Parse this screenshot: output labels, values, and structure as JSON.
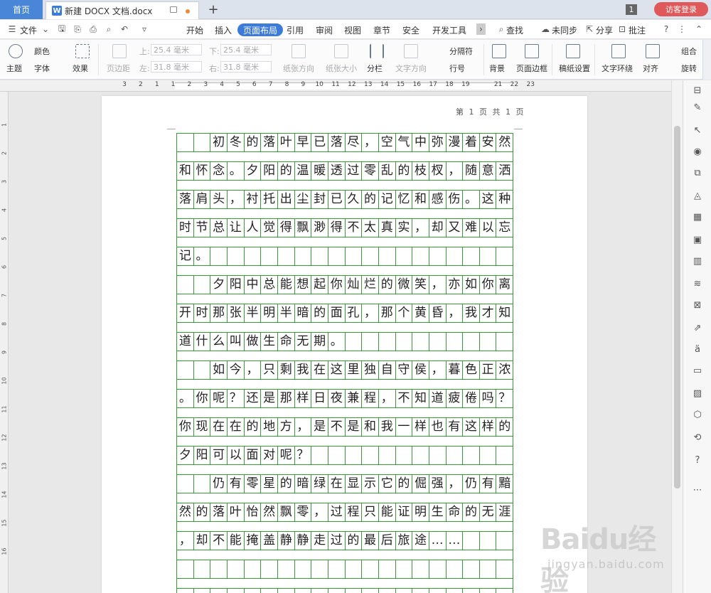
{
  "tabbar": {
    "home_label": "首页",
    "doc_tab_label": "新建 DOCX 文档.docx",
    "new_tab_symbol": "+",
    "window_count": "1",
    "login_label": "访客登录"
  },
  "menu": {
    "file_label": "文件",
    "items": [
      "开始",
      "插入",
      "页面布局",
      "引用",
      "审阅",
      "视图",
      "章节",
      "安全",
      "开发工具"
    ],
    "active_index": 2,
    "search_label": "查找",
    "sync_label": "未同步",
    "share_label": "分享",
    "comment_label": "批注"
  },
  "ribbon": {
    "theme_label": "主题",
    "color_label": "颜色",
    "font_label": "字体",
    "effect_label": "效果",
    "margins_label": "页边距",
    "top_label": "上:",
    "top_value": "25.4 毫米",
    "left_label": "左:",
    "left_value": "31.8 毫米",
    "bottom_label": "下:",
    "bottom_value": "25.4 毫米",
    "right_label": "右:",
    "right_value": "31.8 毫米",
    "orientation_label": "纸张方向",
    "size_label": "纸张大小",
    "columns_label": "分栏",
    "text_direction_label": "文字方向",
    "breaks_label": "分隔符",
    "line_numbers_label": "行号",
    "background_label": "背景",
    "page_border_label": "页面边框",
    "manuscript_label": "稿纸设置",
    "wrap_label": "文字环绕",
    "align_label": "对齐",
    "group_label": "组合",
    "rotate_label": "旋转"
  },
  "ruler": {
    "h_numbers": [
      "3",
      "2",
      "1",
      "1",
      "2",
      "3",
      "4",
      "5",
      "6",
      "7",
      "8",
      "9",
      "10",
      "11",
      "12",
      "13",
      "14",
      "15",
      "16",
      "17",
      "18",
      "19",
      "21",
      "22",
      "23"
    ],
    "v_numbers": [
      "1",
      "2",
      "3",
      "4",
      "5",
      "6",
      "7",
      "8",
      "9",
      "10",
      "11",
      "12",
      "13",
      "14",
      "15",
      "16"
    ]
  },
  "document": {
    "page_number_text": "第 1 页 共 1 页",
    "lines": [
      "  初冬的落叶早已落尽，空气中弥漫着安然",
      "和怀念。夕阳的温暖透过零乱的枝杈，随意洒",
      "落肩头，衬托出尘封已久的记忆和感伤。这种",
      "时节总让人觉得飘渺得不太真实，却又难以忘",
      "记。",
      "  夕阳中总能想起你灿烂的微笑，亦如你离",
      "开时那张半明半暗的面孔，那个黄昏，我才知",
      "道什么叫做生命无期。",
      "  如今，只剩我在这里独自守侯，暮色正浓",
      "。你呢？还是那样日夜兼程，不知道疲倦吗？",
      "你现在在的地方，是不是和我一样也有这样的",
      "夕阳可以面对呢？",
      "  仍有零星的暗绿在显示它的倔强，仍有黯",
      "然的落叶怡然飘零，过程只能证明生命的无涯",
      "，却不能掩盖静静走过的最后旅途……",
      "",
      ""
    ]
  },
  "watermark": {
    "main_text": "Baidu经验",
    "sub_text": "jingyan.baidu.com"
  },
  "colors": {
    "accent": "#3d7bd9",
    "grid_green": "#3a9a3a",
    "login_red": "#e0595a"
  }
}
